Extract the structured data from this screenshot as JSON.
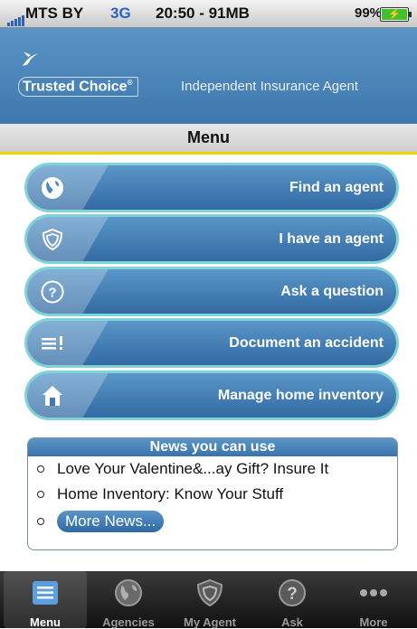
{
  "status_bar": {
    "carrier": "MTS BY",
    "network": "3G",
    "time_memory": "20:50 - 91MB",
    "battery": "99%"
  },
  "header": {
    "logo": "Trusted Choice",
    "tagline": "Independent Insurance Agent"
  },
  "menu_title": "Menu",
  "menu_buttons": [
    {
      "label": "Find an agent",
      "icon": "globe-icon"
    },
    {
      "label": "I have an agent",
      "icon": "shield-icon"
    },
    {
      "label": "Ask a question",
      "icon": "question-icon"
    },
    {
      "label": "Document an accident",
      "icon": "list-exclamation-icon"
    },
    {
      "label": "Manage home inventory",
      "icon": "house-icon"
    }
  ],
  "news": {
    "title": "News you can use",
    "items": [
      "Love Your Valentine&...ay Gift?  Insure It",
      "Home Inventory:  Know Your Stuff"
    ],
    "more": "More News..."
  },
  "tabs": [
    {
      "label": "Menu",
      "icon": "menu-list-icon",
      "active": true
    },
    {
      "label": "Agencies",
      "icon": "globe-icon",
      "active": false
    },
    {
      "label": "My Agent",
      "icon": "shield-icon",
      "active": false
    },
    {
      "label": "Ask",
      "icon": "question-icon",
      "active": false
    },
    {
      "label": "More",
      "icon": "more-dots-icon",
      "active": false
    }
  ],
  "colors": {
    "accent_blue": "#3f78ad",
    "menu_underline": "#f2d400",
    "button_glow": "#7fd3d9",
    "battery_green": "#44c02c"
  }
}
